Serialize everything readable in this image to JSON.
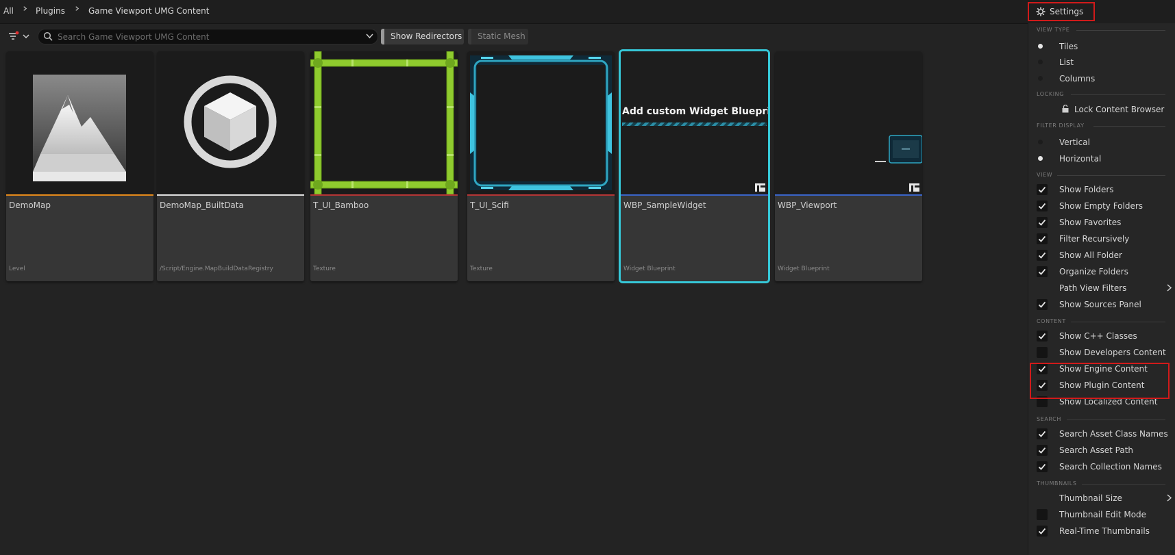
{
  "breadcrumb": {
    "items": [
      "All",
      "Plugins",
      "Game Viewport UMG Content"
    ]
  },
  "settings_button": {
    "label": "Settings"
  },
  "toolbar": {
    "search_placeholder": "Search Game Viewport UMG Content",
    "filters": [
      {
        "label": "Show Redirectors",
        "active": true
      },
      {
        "label": "Static Mesh",
        "active": false
      }
    ]
  },
  "assets": [
    {
      "name": "DemoMap",
      "type": "Level",
      "underline_color": "#e58a1b",
      "thumbnail": "mountain-icon"
    },
    {
      "name": "DemoMap_BuiltData",
      "type": "/Script/Engine.MapBuildDataRegistry",
      "underline_color": "#e0e0e0",
      "thumbnail": "cube-icon"
    },
    {
      "name": "T_UI_Bamboo",
      "type": "Texture",
      "underline_color": "#b53535",
      "thumbnail": "bamboo-frame"
    },
    {
      "name": "T_UI_Scifi",
      "type": "Texture",
      "underline_color": "#b53535",
      "thumbnail": "scifi-frame"
    },
    {
      "name": "WBP_SampleWidget",
      "type": "Widget Blueprint",
      "underline_color": "#3a64c8",
      "thumbnail": "widget-preview",
      "preview_text": "Add custom Widget Blueprints",
      "selected": true
    },
    {
      "name": "WBP_Viewport",
      "type": "Widget Blueprint",
      "underline_color": "#3a64c8",
      "thumbnail": "viewport-preview"
    }
  ],
  "settings_menu": {
    "view_type": {
      "title": "VIEW TYPE",
      "items": [
        {
          "label": "Tiles",
          "selected": true
        },
        {
          "label": "List",
          "selected": false
        },
        {
          "label": "Columns",
          "selected": false
        }
      ]
    },
    "locking": {
      "title": "LOCKING",
      "items": [
        {
          "label": "Lock Content Browser",
          "icon": "unlock-icon"
        }
      ]
    },
    "filter_display": {
      "title": "FILTER DISPLAY",
      "items": [
        {
          "label": "Vertical",
          "selected": false
        },
        {
          "label": "Horizontal",
          "selected": true
        }
      ]
    },
    "view": {
      "title": "VIEW",
      "items": [
        {
          "label": "Show Folders",
          "checked": true
        },
        {
          "label": "Show Empty Folders",
          "checked": true
        },
        {
          "label": "Show Favorites",
          "checked": true
        },
        {
          "label": "Filter Recursively",
          "checked": true
        },
        {
          "label": "Show All Folder",
          "checked": true
        },
        {
          "label": "Organize Folders",
          "checked": true
        },
        {
          "label": "Path View Filters",
          "submenu": true
        },
        {
          "label": "Show Sources Panel",
          "checked": true
        }
      ]
    },
    "content": {
      "title": "CONTENT",
      "items": [
        {
          "label": "Show C++ Classes",
          "checked": true
        },
        {
          "label": "Show Developers Content",
          "checked": false
        },
        {
          "label": "Show Engine Content",
          "checked": true
        },
        {
          "label": "Show Plugin Content",
          "checked": true
        },
        {
          "label": "Show Localized Content",
          "checked": false
        }
      ]
    },
    "search": {
      "title": "SEARCH",
      "items": [
        {
          "label": "Search Asset Class Names",
          "checked": true
        },
        {
          "label": "Search Asset Path",
          "checked": true
        },
        {
          "label": "Search Collection Names",
          "checked": true
        }
      ]
    },
    "thumbnails": {
      "title": "THUMBNAILS",
      "items": [
        {
          "label": "Thumbnail Size",
          "submenu": true
        },
        {
          "label": "Thumbnail Edit Mode",
          "checked": false
        },
        {
          "label": "Real-Time Thumbnails",
          "checked": true
        }
      ]
    }
  },
  "colors": {
    "highlight": "#d11a1a",
    "selection": "#36c8d8"
  }
}
